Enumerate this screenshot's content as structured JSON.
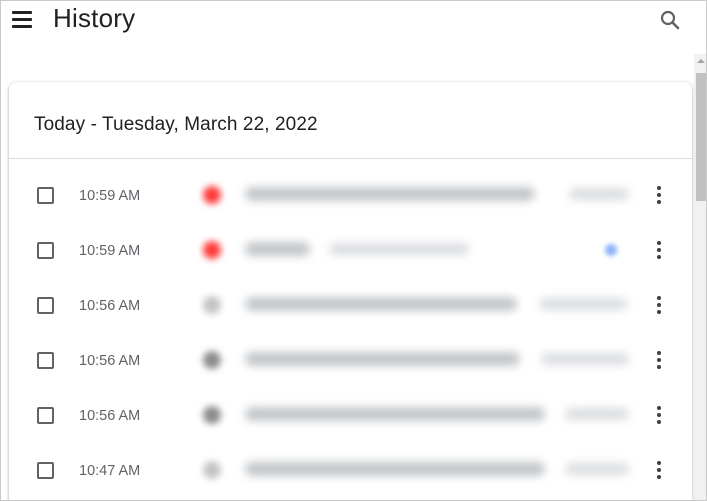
{
  "header": {
    "title": "History",
    "menu_icon": "menu-icon",
    "search_icon": "search-icon"
  },
  "card": {
    "date_heading": "Today - Tuesday, March 22, 2022",
    "rows": [
      {
        "time": "10:59 AM",
        "favicon_color": "#ff3b3b"
      },
      {
        "time": "10:59 AM",
        "favicon_color": "#ff3b3b"
      },
      {
        "time": "10:56 AM",
        "favicon_color": "#c4c4c4"
      },
      {
        "time": "10:56 AM",
        "favicon_color": "#8c8c8c"
      },
      {
        "time": "10:56 AM",
        "favicon_color": "#8c8c8c"
      },
      {
        "time": "10:47 AM",
        "favicon_color": "#c4c4c4"
      }
    ]
  },
  "colors": {
    "text_primary": "#202124",
    "text_secondary": "#5f6368",
    "divider": "#dadce0",
    "badge_dot": "#8ab4f8"
  }
}
